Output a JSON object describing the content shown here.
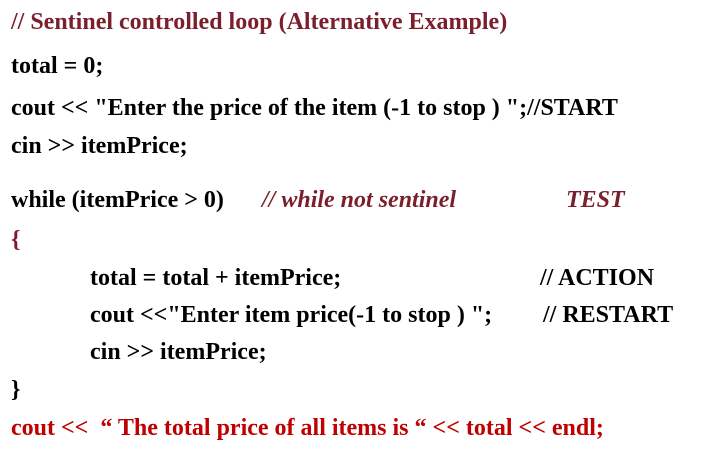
{
  "lines": {
    "comment_title": "// Sentinel controlled loop (Alternative Example)",
    "init_total": "total = 0;",
    "prompt_start": "cout << \"Enter the price of the item (-1 to stop ) \";//START",
    "read_first": "cin >> itemPrice;",
    "while_head": "while (itemPrice > 0)",
    "while_comment": "// while not sentinel",
    "test_label": "TEST",
    "open_brace": "{",
    "accumulate": "total = total + itemPrice;",
    "action_comment": "// ACTION",
    "prompt_restart": "cout <<\"Enter item price(-1 to stop ) \";",
    "restart_comment": "// RESTART",
    "read_next": "cin >> itemPrice;",
    "close_brace": "}",
    "output_total": "cout <<  “ The total price of all items is “ << total << endl;"
  },
  "colors": {
    "dark_red": "#7a1f2b",
    "red": "#c00000",
    "text": "#000000"
  }
}
